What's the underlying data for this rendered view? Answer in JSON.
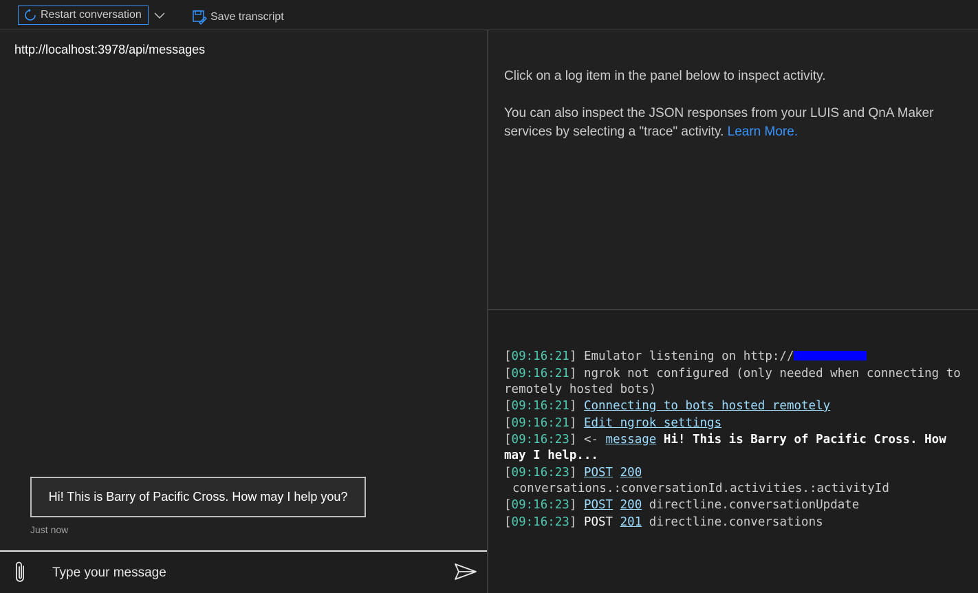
{
  "toolbar": {
    "restart_label": "Restart conversation",
    "save_label": "Save transcript"
  },
  "chat": {
    "endpoint": "http://localhost:3978/api/messages",
    "bot_message": "Hi! This is Barry of Pacific Cross. How may I help you?",
    "timestamp": "Just now",
    "input_placeholder": "Type your message"
  },
  "inspector": {
    "line1": "Click on a log item in the panel below to inspect activity.",
    "line2": "You can also inspect the JSON responses from your LUIS and QnA Maker services by selecting a \"trace\" activity.",
    "learn_more": "Learn More."
  },
  "log": {
    "entries": [
      {
        "time": "09:16:21",
        "text": "Emulator listening on http://"
      },
      {
        "time": "09:16:21",
        "text": "ngrok not configured (only needed when connecting to remotely hosted bots)"
      },
      {
        "time": "09:16:21",
        "link": "Connecting to bots hosted remotely"
      },
      {
        "time": "09:16:21",
        "link": "Edit ngrok settings"
      },
      {
        "time": "09:16:23",
        "prefix": "<- ",
        "link": "message",
        "text": "Hi! This is Barry of Pacific Cross. How may I help..."
      },
      {
        "time": "09:16:23",
        "method": "POST",
        "status": "200",
        "text": "conversations.:conversationId.activities.:activityId"
      },
      {
        "time": "09:16:23",
        "method": "POST",
        "status": "200",
        "text": "directline.conversationUpdate"
      },
      {
        "time": "09:16:23",
        "method": "POST",
        "status": "201",
        "text": "directline.conversations"
      }
    ]
  },
  "colors": {
    "accent": "#3794ff",
    "timestamp_green": "#4ec9b0",
    "link_blue": "#9cdcfe",
    "redaction": "#0000ff"
  },
  "icons": {
    "restart": "refresh-icon",
    "dropdown": "chevron-down-icon",
    "save": "save-transcript-icon",
    "attach": "paperclip-icon",
    "send": "send-icon"
  }
}
